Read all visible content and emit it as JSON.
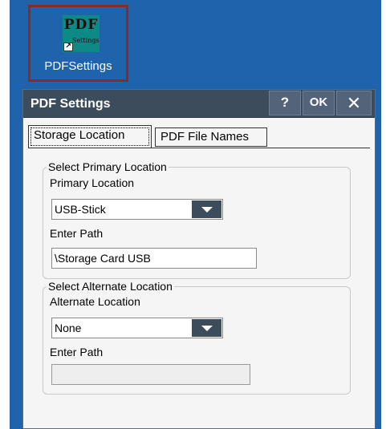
{
  "desktop_icon": {
    "glyph_big": "PDF",
    "glyph_small": "Settings",
    "caption": "PDFSettings"
  },
  "window": {
    "title": "PDF Settings",
    "help_label": "?",
    "ok_label": "OK",
    "close_label": "✕"
  },
  "tabs": [
    {
      "label": "Storage Location"
    },
    {
      "label": "PDF File Names"
    }
  ],
  "primary": {
    "group_label": "Select Primary Location",
    "location_label": "Primary Location",
    "location_value": "USB-Stick",
    "path_label": "Enter Path",
    "path_value": "\\Storage Card USB"
  },
  "alternate": {
    "group_label": "Select Alternate Location",
    "location_label": "Alternate Location",
    "location_value": "None",
    "path_label": "Enter Path",
    "path_value": ""
  }
}
